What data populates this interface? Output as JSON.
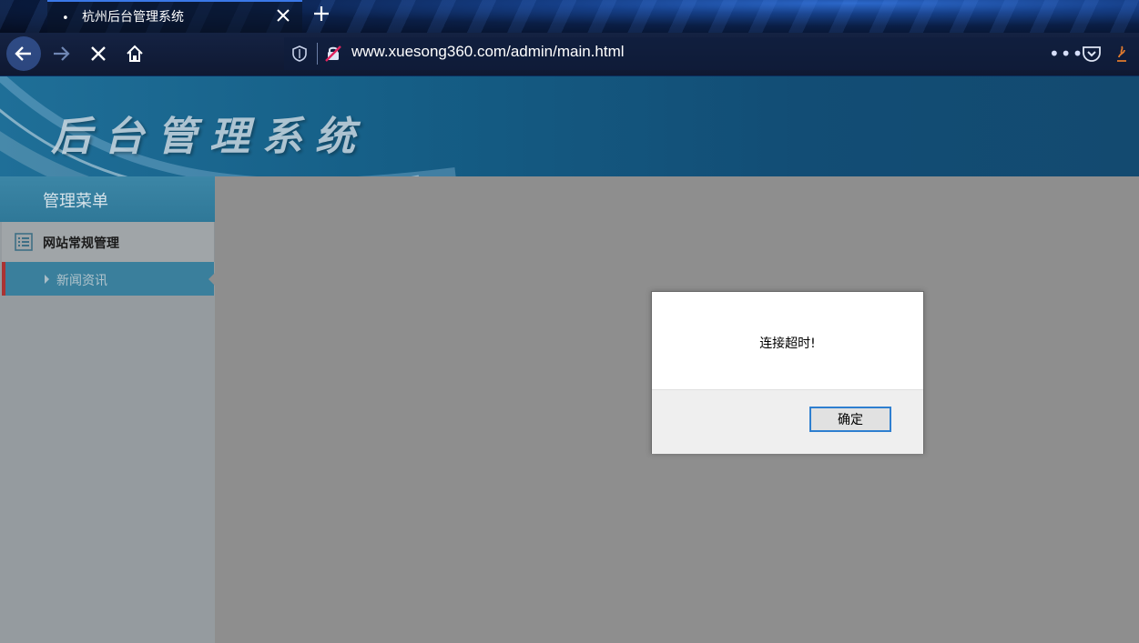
{
  "browser": {
    "tab": {
      "title": "杭州后台管理系统"
    },
    "url": "www.xuesong360.com/admin/main.html",
    "icons": [
      "back-icon",
      "forward-icon",
      "stop-icon",
      "home-icon",
      "shield-icon",
      "insecure-lock-icon",
      "more-icon",
      "pocket-icon",
      "extension-icon",
      "close-icon",
      "plus-icon"
    ]
  },
  "page": {
    "banner_title": "后台管理系统",
    "sidebar": {
      "header": "管理菜单",
      "groups": [
        {
          "label": "网站常规管理",
          "items": [
            {
              "label": "新闻资讯",
              "active": true
            }
          ]
        }
      ]
    }
  },
  "dialog": {
    "message": "连接超时!",
    "ok_label": "确定"
  },
  "colors": {
    "banner": "#155e86",
    "sidebar_header": "#3580a0",
    "active_item": "#3a7f9c",
    "active_marker": "#aa3333",
    "overlay_gray": "#8e8e8e",
    "focus_blue": "#2e7fd0"
  }
}
